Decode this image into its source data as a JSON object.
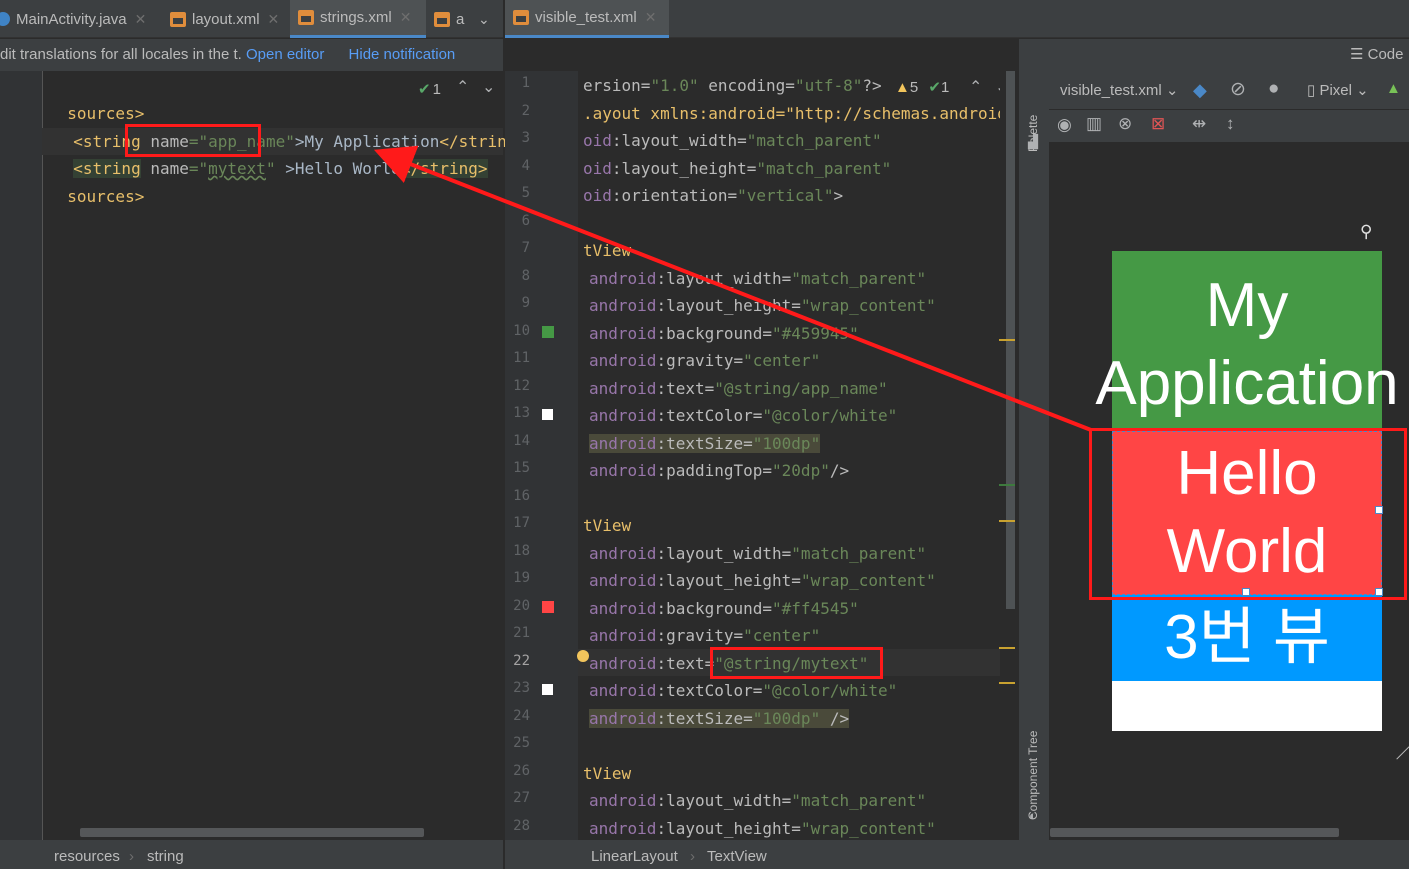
{
  "left_tabs": [
    {
      "label": "MainActivity.java",
      "kind": "java"
    },
    {
      "label": "layout.xml",
      "kind": "xml"
    },
    {
      "label": "strings.xml",
      "kind": "xml",
      "active": true
    },
    {
      "label": "a",
      "kind": "xml"
    }
  ],
  "right_tabs": [
    {
      "label": "visible_test.xml",
      "kind": "xml",
      "active": true
    }
  ],
  "notification": {
    "text": "dit translations for all locales in the t.",
    "open_editor": "Open editor",
    "hide": "Hide notification"
  },
  "strings_editor": {
    "inspection": {
      "count": "1"
    },
    "lines": [
      {
        "p1": "sources>"
      },
      {
        "p1": "<string",
        "p2": "name",
        "p3": "=\"app_name\"",
        "p4": ">My Application",
        "p5": "</strin"
      },
      {
        "p1": "<string",
        "p2": "name",
        "p3": "=\"",
        "p3b": "mytext",
        "p3c": "\"",
        "p4": ">Hello World",
        "p5": "</string>"
      },
      {
        "p1": "sources>"
      }
    ]
  },
  "layout_editor": {
    "inspection": {
      "warnings": "5",
      "checks": "1"
    },
    "line_numbers": [
      "1",
      "2",
      "3",
      "4",
      "5",
      "6",
      "7",
      "8",
      "9",
      "10",
      "11",
      "12",
      "13",
      "14",
      "15",
      "16",
      "17",
      "18",
      "19",
      "20",
      "21",
      "22",
      "23",
      "24",
      "25",
      "26",
      "27",
      "28"
    ],
    "current_line": "22",
    "lines": [
      [
        "ersion=\"1.0\" encoding=\"utf-8\"?>"
      ],
      [
        ".ayout xmlns:android=\"http://schemas.android"
      ],
      [
        "oid:layout_width=\"match_parent\""
      ],
      [
        "oid:layout_height=\"match_parent\""
      ],
      [
        "oid:orientation=\"vertical\">"
      ],
      [
        ""
      ],
      [
        "tView"
      ],
      [
        "android:layout_width=\"match_parent\""
      ],
      [
        "android:layout_height=\"wrap_content\""
      ],
      [
        "android:background=\"#459945\""
      ],
      [
        "android:gravity=\"center\""
      ],
      [
        "android:text=\"@string/app_name\""
      ],
      [
        "android:textColor=\"@color/white\""
      ],
      [
        "android:textSize=\"100dp\""
      ],
      [
        "android:paddingTop=\"20dp\"/>"
      ],
      [
        ""
      ],
      [
        "tView"
      ],
      [
        "android:layout_width=\"match_parent\""
      ],
      [
        "android:layout_height=\"wrap_content\""
      ],
      [
        "android:background=\"#ff4545\""
      ],
      [
        "android:gravity=\"center\""
      ],
      [
        "android:text=\"@string/mytext\""
      ],
      [
        "android:textColor=\"@color/white\""
      ],
      [
        "android:textSize=\"100dp\" />"
      ],
      [
        ""
      ],
      [
        "tView"
      ],
      [
        "android:layout_width=\"match_parent\""
      ],
      [
        "android:layout_height=\"wrap_content\""
      ]
    ]
  },
  "design_toolbar": {
    "file": "visible_test.xml",
    "device": "Pixel",
    "code_label": "Code"
  },
  "side_labels": {
    "palette": "Palette",
    "component_tree": "Component Tree"
  },
  "preview": {
    "view1": {
      "text": "My Application",
      "bg": "#459945"
    },
    "view2": {
      "text": "Hello World",
      "bg": "#ff4545"
    },
    "view3": {
      "text": "3번 뷰",
      "bg": "#0099ff"
    }
  },
  "breadcrumbs_left": [
    "resources",
    "string"
  ],
  "breadcrumbs_right": [
    "LinearLayout",
    "TextView"
  ],
  "colors": {
    "annotation": "#ff1a1a"
  }
}
